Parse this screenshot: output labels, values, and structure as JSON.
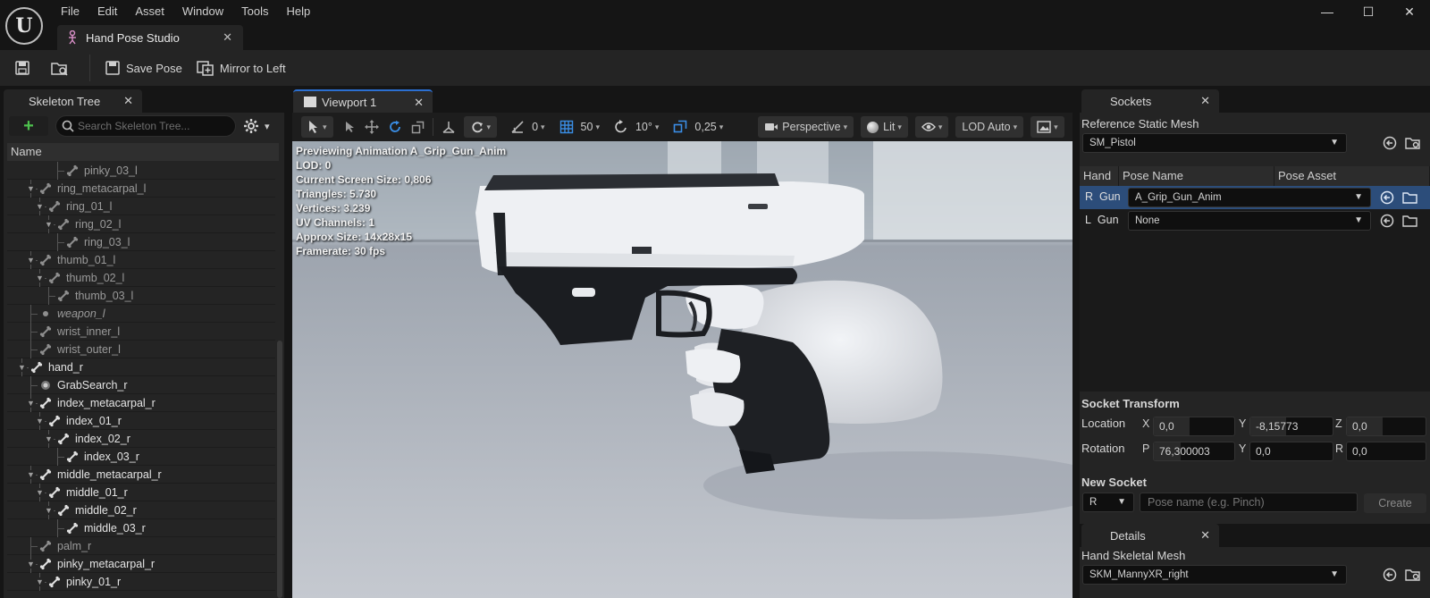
{
  "menu": [
    "File",
    "Edit",
    "Asset",
    "Window",
    "Tools",
    "Help"
  ],
  "document_tab": "Hand Pose Studio",
  "toolbar": {
    "save_pose": "Save Pose",
    "mirror_to_left": "Mirror to Left"
  },
  "skeleton_tree": {
    "tab": "Skeleton Tree",
    "search_placeholder": "Search Skeleton Tree...",
    "column": "Name",
    "items": [
      {
        "label": "pinky_03_l",
        "depth": 5,
        "style": "dim",
        "icon": "bone"
      },
      {
        "label": "ring_metacarpal_l",
        "depth": 2,
        "style": "dim",
        "icon": "bone",
        "expanded": true
      },
      {
        "label": "ring_01_l",
        "depth": 3,
        "style": "dim",
        "icon": "bone",
        "expanded": true
      },
      {
        "label": "ring_02_l",
        "depth": 4,
        "style": "dim",
        "icon": "bone",
        "expanded": true
      },
      {
        "label": "ring_03_l",
        "depth": 5,
        "style": "dim",
        "icon": "bone"
      },
      {
        "label": "thumb_01_l",
        "depth": 2,
        "style": "dim",
        "icon": "bone",
        "expanded": true
      },
      {
        "label": "thumb_02_l",
        "depth": 3,
        "style": "dim",
        "icon": "bone",
        "expanded": true
      },
      {
        "label": "thumb_03_l",
        "depth": 4,
        "style": "dim",
        "icon": "bone"
      },
      {
        "label": "weapon_l",
        "depth": 2,
        "style": "dim italic",
        "icon": "dot"
      },
      {
        "label": "wrist_inner_l",
        "depth": 2,
        "style": "dim",
        "icon": "bone"
      },
      {
        "label": "wrist_outer_l",
        "depth": 2,
        "style": "dim",
        "icon": "bone"
      },
      {
        "label": "hand_r",
        "depth": 1,
        "style": "bright",
        "icon": "bone",
        "expanded": true
      },
      {
        "label": "GrabSearch_r",
        "depth": 2,
        "style": "bright",
        "icon": "socket"
      },
      {
        "label": "index_metacarpal_r",
        "depth": 2,
        "style": "bright",
        "icon": "bone",
        "expanded": true
      },
      {
        "label": "index_01_r",
        "depth": 3,
        "style": "bright",
        "icon": "bone",
        "expanded": true
      },
      {
        "label": "index_02_r",
        "depth": 4,
        "style": "bright",
        "icon": "bone",
        "expanded": true
      },
      {
        "label": "index_03_r",
        "depth": 5,
        "style": "bright",
        "icon": "bone"
      },
      {
        "label": "middle_metacarpal_r",
        "depth": 2,
        "style": "bright",
        "icon": "bone",
        "expanded": true
      },
      {
        "label": "middle_01_r",
        "depth": 3,
        "style": "bright",
        "icon": "bone",
        "expanded": true
      },
      {
        "label": "middle_02_r",
        "depth": 4,
        "style": "bright",
        "icon": "bone",
        "expanded": true
      },
      {
        "label": "middle_03_r",
        "depth": 5,
        "style": "bright",
        "icon": "bone"
      },
      {
        "label": "palm_r",
        "depth": 2,
        "style": "dim",
        "icon": "bone"
      },
      {
        "label": "pinky_metacarpal_r",
        "depth": 2,
        "style": "bright",
        "icon": "bone",
        "expanded": true
      },
      {
        "label": "pinky_01_r",
        "depth": 3,
        "style": "bright",
        "icon": "bone",
        "expanded": true
      }
    ]
  },
  "viewport": {
    "tab": "Viewport 1",
    "toolbar": {
      "angle_snap": "0",
      "grid_snap": "50",
      "rotation_snap": "10°",
      "scale_snap": "0,25",
      "perspective": "Perspective",
      "lit": "Lit",
      "lod": "LOD Auto"
    },
    "overlay": [
      "Previewing Animation A_Grip_Gun_Anim",
      "LOD: 0",
      "Current Screen Size: 0,806",
      "Triangles: 5.730",
      "Vertices: 3.239",
      "UV Channels: 1",
      "Approx Size: 14x28x15",
      "Framerate: 30 fps"
    ]
  },
  "sockets": {
    "tab": "Sockets",
    "reference_label": "Reference Static Mesh",
    "reference_value": "SM_Pistol",
    "columns": [
      "Hand",
      "Pose Name",
      "Pose Asset"
    ],
    "rows": [
      {
        "hand": "R",
        "name": "Gun",
        "pose": "A_Grip_Gun_Anim",
        "selected": true
      },
      {
        "hand": "L",
        "name": "Gun",
        "pose": "None",
        "selected": false
      }
    ],
    "transform_label": "Socket Transform",
    "location_label": "Location",
    "rotation_label": "Rotation",
    "location": {
      "x": "0,0",
      "y": "-8,15773",
      "z": "0,0"
    },
    "rotation": {
      "p": "76,300003",
      "y": "0,0",
      "r": "0,0"
    },
    "new_socket_label": "New Socket",
    "new_socket_hand": "R",
    "new_socket_placeholder": "Pose name (e.g. Pinch)",
    "create": "Create"
  },
  "details": {
    "tab": "Details",
    "label": "Hand Skeletal Mesh",
    "value": "SKM_MannyXR_right"
  },
  "colors": {
    "accent": "#2b6fd1",
    "add_green": "#4ec24e",
    "selected_row": "#2c4d7a"
  }
}
